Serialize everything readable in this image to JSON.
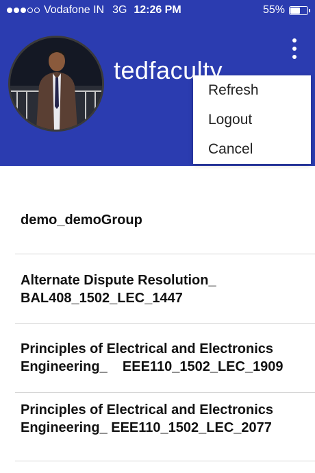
{
  "status_bar": {
    "carrier": "Vodafone IN",
    "network": "3G",
    "time": "12:26 PM",
    "battery": "55%",
    "battery_level": 0.55
  },
  "header": {
    "username": "tedfaculty",
    "menu_icon": "more-vertical-icon"
  },
  "menu": {
    "items": [
      "Refresh",
      "Logout",
      "Cancel"
    ]
  },
  "groups": [
    {
      "title": "demo_demoGroup"
    },
    {
      "title": "Alternate Dispute Resolution_ BAL408_1502_LEC_1447"
    },
    {
      "title": "Principles of Electrical and Electronics Engineering_    EEE110_1502_LEC_1909"
    },
    {
      "title": "Principles of Electrical and Electronics Engineering_ EEE110_1502_LEC_2077"
    }
  ],
  "colors": {
    "header_bg": "#2b3cb0",
    "text": "#111111",
    "divider": "#d6d6d6"
  }
}
